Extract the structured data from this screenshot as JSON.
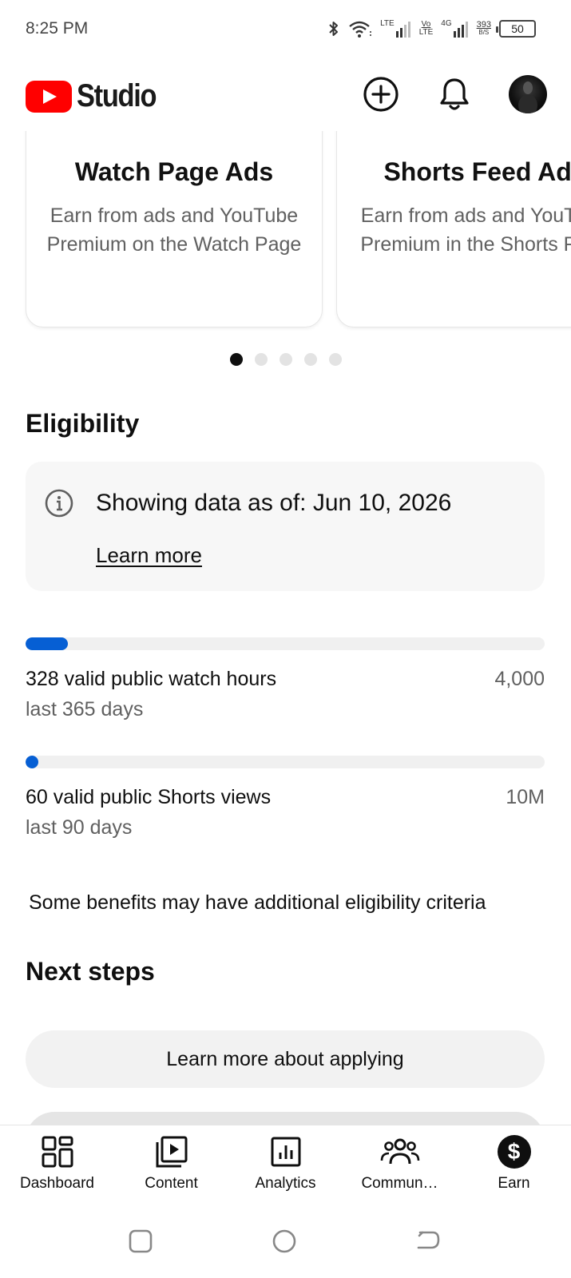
{
  "status_bar": {
    "time": "8:25 PM",
    "network_1": "LTE",
    "volte_top": "Vo",
    "volte_bottom": "LTE",
    "network_2": "4G",
    "data_speed_value": "393",
    "data_speed_unit": "B/S",
    "battery": "50"
  },
  "app_bar": {
    "logo_text": "Studio"
  },
  "carousel": {
    "cards": [
      {
        "title": "Watch Page Ads",
        "description": "Earn from ads and YouTube Premium on the Watch Page"
      },
      {
        "title": "Shorts Feed Ads",
        "description": "Earn from ads and YouTube Premium in the Shorts Feed"
      }
    ],
    "page_count": 5,
    "active_page": 1
  },
  "eligibility": {
    "title": "Eligibility",
    "info_text": "Showing data as of: Jun 10, 2026",
    "learn_more": "Learn more",
    "metrics": [
      {
        "label": "328 valid public watch hours",
        "target": "4,000",
        "period": "last 365 days",
        "progress": 0.082
      },
      {
        "label": "60 valid public Shorts views",
        "target": "10M",
        "period": "last 90 days",
        "progress": 6e-06
      }
    ],
    "note": "Some benefits may have additional eligibility criteria"
  },
  "next_steps": {
    "title": "Next steps",
    "button_label": "Learn more about applying"
  },
  "bottom_nav": {
    "items": [
      {
        "label": "Dashboard",
        "icon": "dashboard-icon"
      },
      {
        "label": "Content",
        "icon": "content-icon"
      },
      {
        "label": "Analytics",
        "icon": "analytics-icon"
      },
      {
        "label": "Commun…",
        "icon": "community-icon"
      },
      {
        "label": "Earn",
        "icon": "earn-icon",
        "active": true
      }
    ]
  },
  "colors": {
    "brand_red": "#ff0000",
    "progress_blue": "#065fd4"
  }
}
